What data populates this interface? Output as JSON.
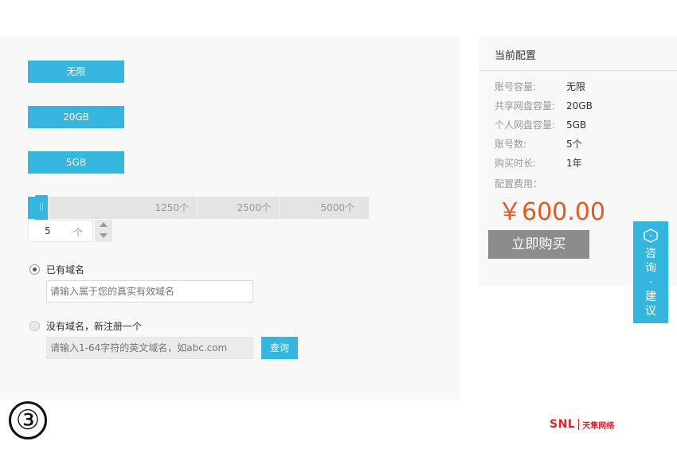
{
  "options": {
    "unlimited": "无限",
    "gb20": "20GB",
    "gb5": "5GB"
  },
  "slider": {
    "ticks": [
      "1250个",
      "2500个",
      "5000个"
    ]
  },
  "stepper": {
    "value": "5",
    "unit": "个"
  },
  "domain": {
    "have_label": "已有域名",
    "have_placeholder": "请输入属于您的真实有效域名",
    "register_label": "没有域名，新注册一个",
    "register_placeholder": "请输入1-64字符的英文域名，如abc.com",
    "query_label": "查询"
  },
  "step_number": "③",
  "config": {
    "title": "当前配置",
    "rows": [
      {
        "label": "账号容量:",
        "value": "无限"
      },
      {
        "label": "共享网盘容量:",
        "value": "20GB"
      },
      {
        "label": "个人网盘容量:",
        "value": "5GB"
      },
      {
        "label": "账号数:",
        "value": "5个"
      },
      {
        "label": "购买时长:",
        "value": "1年"
      }
    ],
    "fee_label": "配置费用：",
    "price": "￥600.00",
    "buy_label": "立即购买"
  },
  "feedback": {
    "text_line1": "咨",
    "text_line2": "询",
    "dot": "·",
    "text_line3": "建",
    "text_line4": "议"
  },
  "logo": {
    "brand": "SNL",
    "cn": "天隼网络"
  },
  "colors": {
    "accent": "#35b6de",
    "price": "#e35a21",
    "buy_button": "#8c8c8c",
    "logo": "#d9232e"
  }
}
